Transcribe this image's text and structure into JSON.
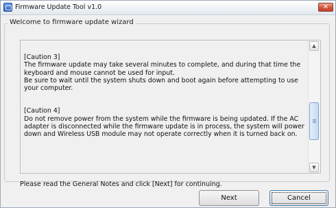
{
  "window": {
    "title": "Firmware Update Tool v1.0",
    "close_label": "✕"
  },
  "wizard": {
    "group_title": "Welcome to firmware update wizard",
    "caution3_heading": "[Caution 3]",
    "caution3_body": "The firmware update may take several minutes to complete, and during that time the keyboard and mouse cannot be used for input.\nBe sure to wait until the system shuts down and boot again before attempting to use your computer.",
    "caution4_heading": "[Caution 4]",
    "caution4_body": "Do not remove power from the system while the firmware is being updated. If the AC adapter is disconnected while the firmware update is in process, the system will power down and Wireless USB module may not operate correctly when it is turned back on.",
    "note": "Please read the General Notes and click [Next] for continuing."
  },
  "buttons": {
    "next": "Next",
    "cancel": "Cancel"
  }
}
